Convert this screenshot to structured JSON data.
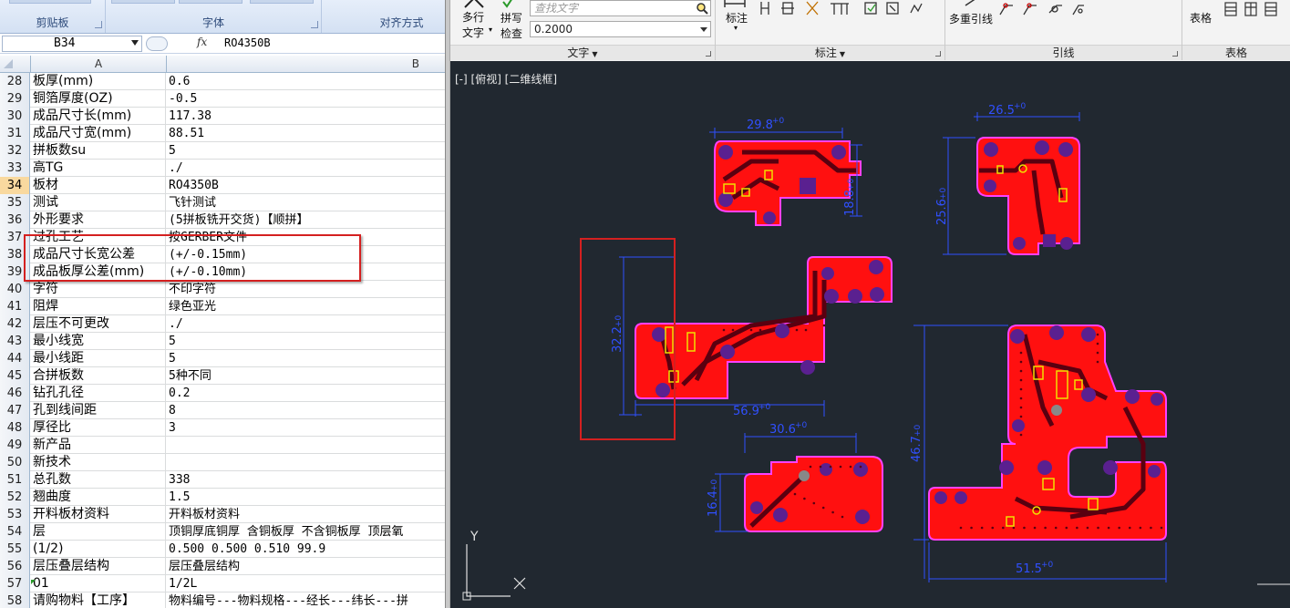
{
  "excel": {
    "ribbon": {
      "groups": [
        {
          "label": "剪贴板"
        },
        {
          "label": "字体"
        },
        {
          "label": "对齐方式"
        }
      ]
    },
    "formula_bar": {
      "name_box": "B34",
      "fx_label": "fx",
      "value": "RO4350B"
    },
    "columns": [
      "A",
      "B"
    ],
    "rows": [
      {
        "n": "28",
        "a": "板厚(mm)",
        "b": "0.6"
      },
      {
        "n": "29",
        "a": "铜箔厚度(OZ)",
        "b": "-0.5"
      },
      {
        "n": "30",
        "a": "成品尺寸长(mm)",
        "b": "117.38"
      },
      {
        "n": "31",
        "a": "成品尺寸宽(mm)",
        "b": "88.51"
      },
      {
        "n": "32",
        "a": "拼板数su",
        "b": "5"
      },
      {
        "n": "33",
        "a": "高TG",
        "b": "./"
      },
      {
        "n": "34",
        "a": "板材",
        "b": "RO4350B"
      },
      {
        "n": "35",
        "a": "测试",
        "b": "飞针测试"
      },
      {
        "n": "36",
        "a": "外形要求",
        "b": "(5拼板铣开交货)【顺拼】"
      },
      {
        "n": "37",
        "a": "过孔工艺",
        "b": "按GERBER文件"
      },
      {
        "n": "38",
        "a": "成品尺寸长宽公差",
        "b": "(+/-0.15mm)"
      },
      {
        "n": "39",
        "a": "成品板厚公差(mm)",
        "b": "(+/-0.10mm)"
      },
      {
        "n": "40",
        "a": "字符",
        "b": "不印字符"
      },
      {
        "n": "41",
        "a": "阻焊",
        "b": "绿色亚光"
      },
      {
        "n": "42",
        "a": "层压不可更改",
        "b": "./"
      },
      {
        "n": "43",
        "a": "最小线宽",
        "b": "5"
      },
      {
        "n": "44",
        "a": "最小线距",
        "b": "5"
      },
      {
        "n": "45",
        "a": "合拼板数",
        "b": "5种不同"
      },
      {
        "n": "46",
        "a": "钻孔孔径",
        "b": "0.2"
      },
      {
        "n": "47",
        "a": "孔到线间距",
        "b": "8"
      },
      {
        "n": "48",
        "a": "厚径比",
        "b": "3"
      },
      {
        "n": "49",
        "a": "新产品",
        "b": ""
      },
      {
        "n": "50",
        "a": "新技术",
        "b": ""
      },
      {
        "n": "51",
        "a": "总孔数",
        "b": "338"
      },
      {
        "n": "52",
        "a": "翘曲度",
        "b": "1.5"
      },
      {
        "n": "53",
        "a": "开料板材资料",
        "b": "开料板材资料"
      },
      {
        "n": "54",
        "a": "层",
        "b": "顶铜厚底铜厚 含铜板厚 不含铜板厚 顶层氧"
      },
      {
        "n": "55",
        "a": "(1/2)",
        "b": "0.500  0.500        0.510       99.9"
      },
      {
        "n": "56",
        "a": "层压叠层结构",
        "b": "层压叠层结构"
      },
      {
        "n": "57",
        "a": "01",
        "b": "1/2L"
      },
      {
        "n": "58",
        "a": "请购物料【工序】",
        "b": "物料编号---物料规格---经长---纬长---拼"
      }
    ]
  },
  "cad": {
    "ribbon": {
      "text_panel": {
        "label": "文字",
        "multiline_text": [
          "多行",
          "文字"
        ],
        "spell_check": [
          "拼写",
          "检查"
        ],
        "find_placeholder": "查找文字",
        "height_value": "0.2000"
      },
      "dim_panel": {
        "label": "标注",
        "dim_button": "标注"
      },
      "leader_panel": {
        "label": "引线",
        "multileader": "多重引线"
      },
      "table_panel": {
        "label": "表格",
        "table_button": "表格"
      }
    },
    "viewport_label": "[-] [俯视] [二维线框]",
    "dimensions": [
      "29.8",
      "26.5",
      "18.8",
      "25.6",
      "32.2",
      "56.9",
      "30.6",
      "16.4",
      "46.7",
      "51.5"
    ],
    "ucs": {
      "x": "X",
      "y": "Y"
    }
  },
  "colors": {
    "board": "#ff1010",
    "board_outline": "#ff40ff",
    "trace": "#5a0010",
    "pad": "#5a2090",
    "silk": "#f0e000",
    "dim": "#3050ff",
    "canvas_bg": "#212830",
    "highlight": "#d42020"
  }
}
